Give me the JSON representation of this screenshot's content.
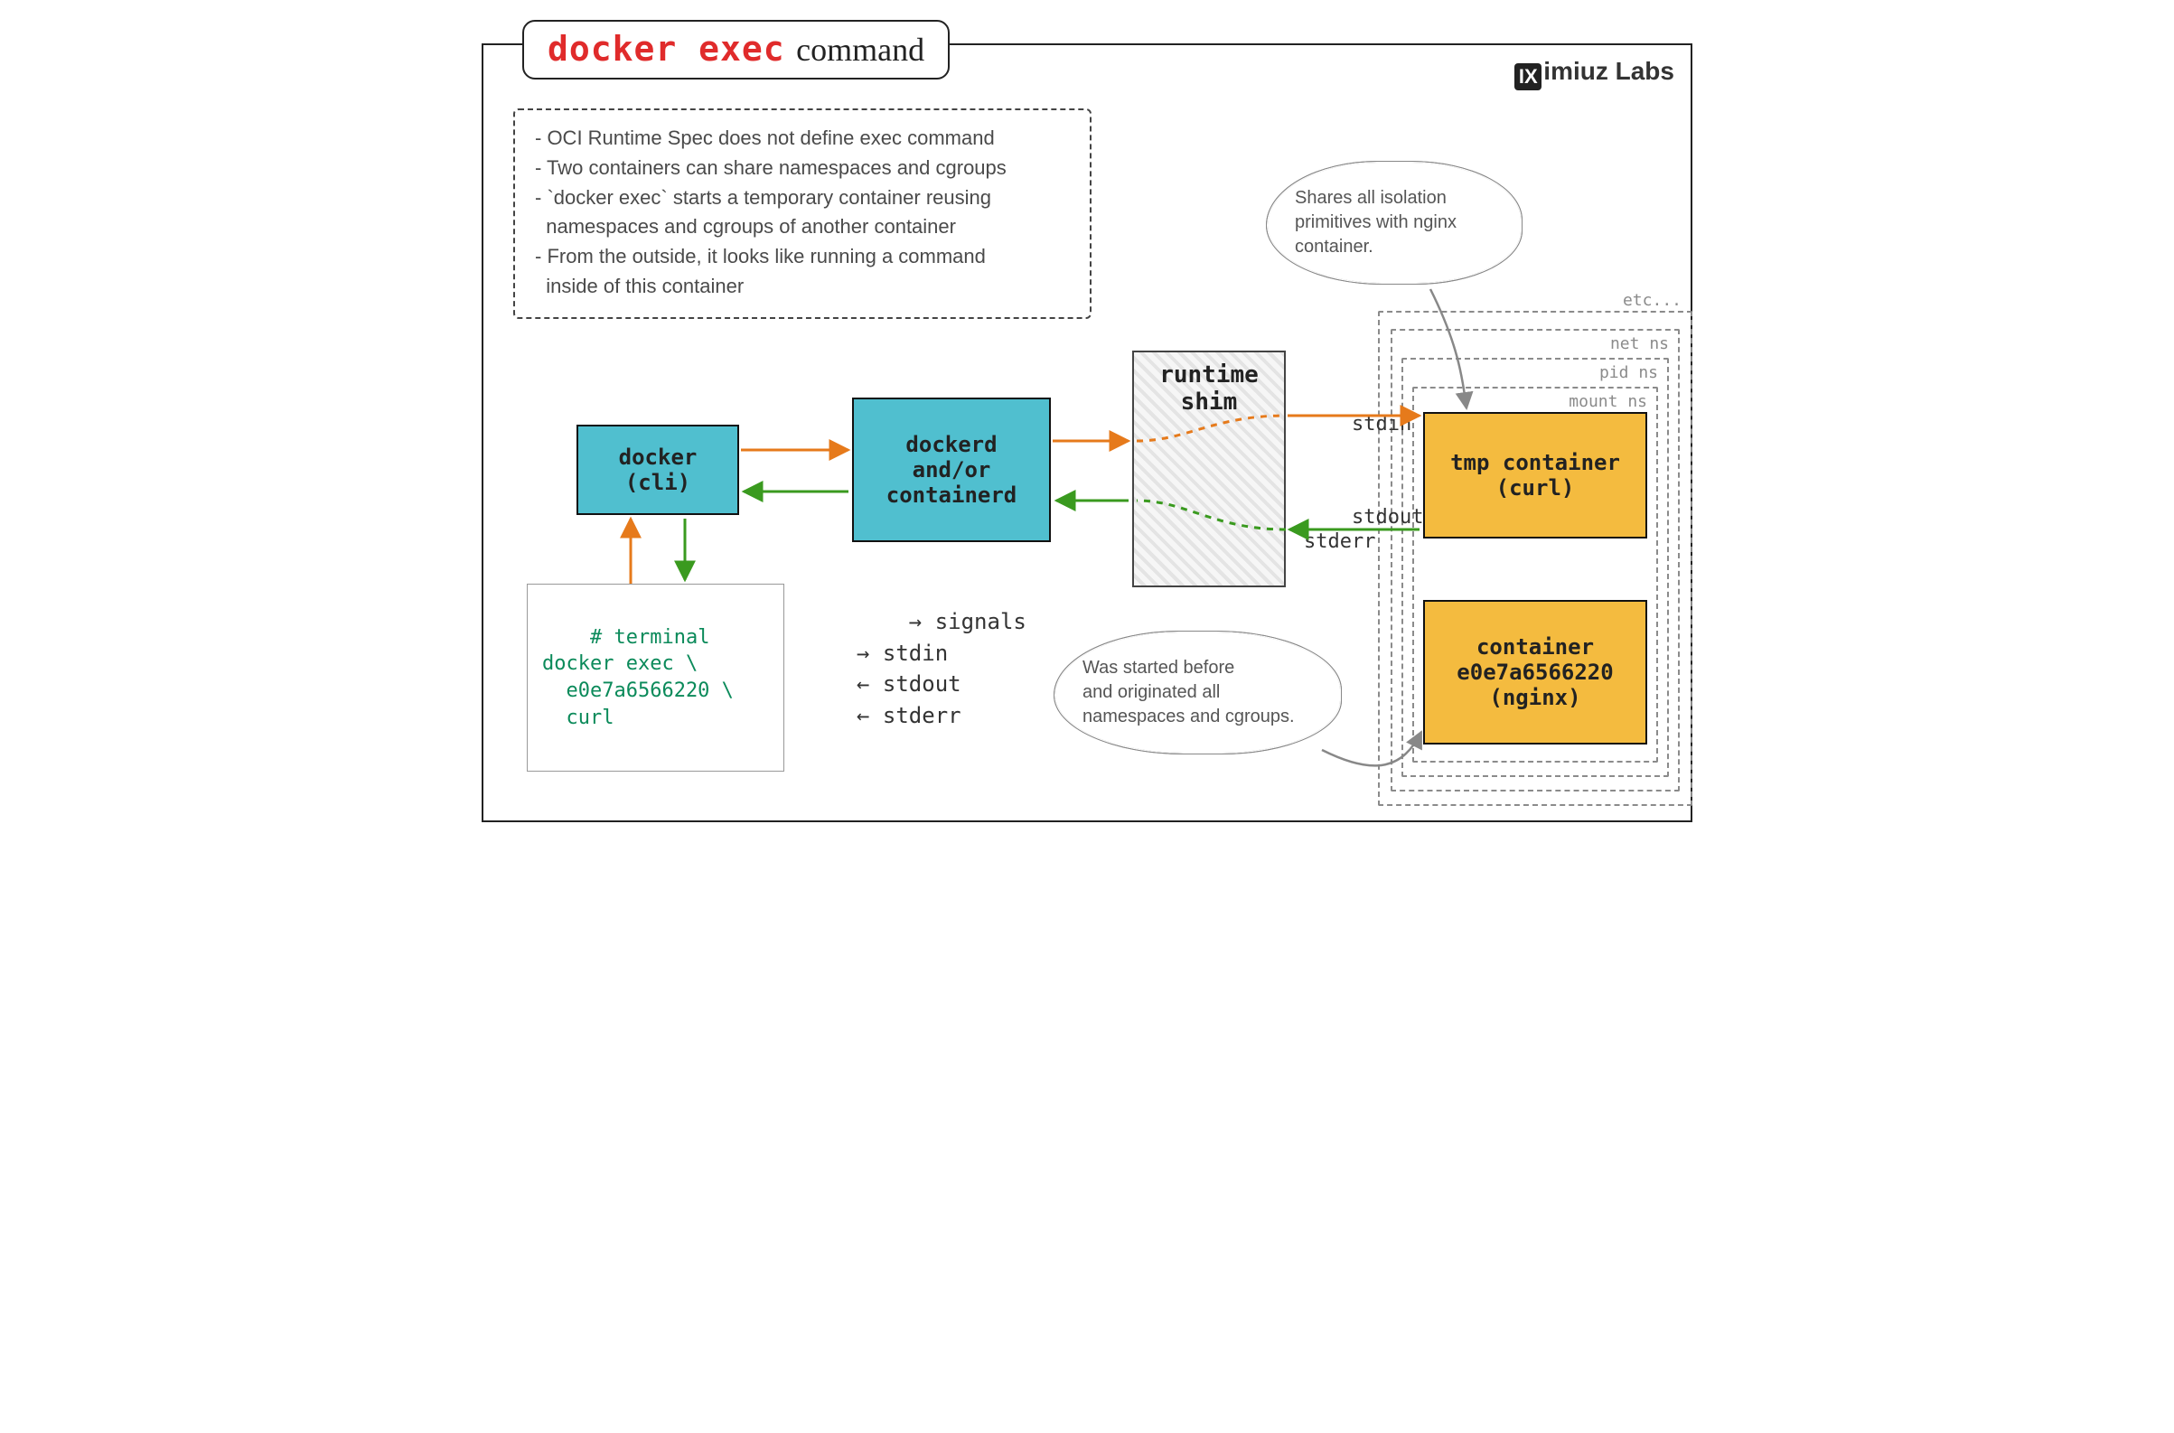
{
  "title": {
    "code": "docker exec",
    "suffix": "command"
  },
  "branding": "imiuz Labs",
  "notes": [
    "- OCI Runtime Spec does not define exec command",
    "- Two containers can share namespaces and cgroups",
    "- `docker exec` starts a temporary container reusing",
    "  namespaces and cgroups of another container",
    "- From the outside, it looks like running a command",
    "  inside of this container"
  ],
  "boxes": {
    "cli": "docker\n(cli)",
    "dockerd": "dockerd\nand/or\ncontainerd",
    "shim": "runtime\nshim",
    "tmp": "tmp container\n(curl)",
    "nginx": "container\ne0e7a6566220\n(nginx)"
  },
  "terminal": "# terminal\ndocker exec \\\n  e0e7a6566220 \\\n  curl",
  "signals": "→ signals\n→ stdin\n← stdout\n← stderr",
  "streams": {
    "stdin": "stdin",
    "stdout": "stdout\nstderr"
  },
  "namespaces": {
    "mount": "mount ns",
    "pid": "pid ns",
    "net": "net ns",
    "etc": "etc..."
  },
  "clouds": {
    "top": "Shares all isolation\nprimitives with nginx\ncontainer.",
    "bottom": "Was started before\nand originated all\nnamespaces and cgroups."
  },
  "colors": {
    "orange": "#e67a1b",
    "green": "#3a9a1f",
    "gray": "#888"
  }
}
